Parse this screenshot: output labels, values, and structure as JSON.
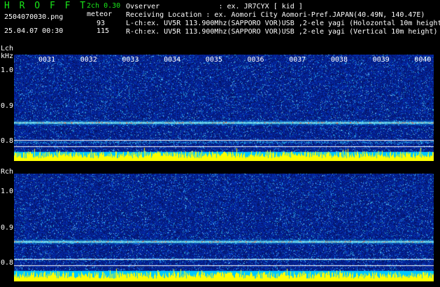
{
  "header": {
    "app_name": "H R O F F T",
    "version": "2ch 0.30",
    "filename": "2504070030.png",
    "mode_label": "meteor",
    "count_lch": "93",
    "count_rch": "115",
    "datetime": "25.04.07 00:30"
  },
  "info": {
    "observer": "Ovserver              : ex. JR7CYX [ kid ]",
    "location": "Receiving Location : ex. Aomori City Aomori-Pref.JAPAN(40.49N, 140.47E)",
    "lch": "L-ch:ex. UV5R 113.900Mhz(SAPPORO VOR)USB ,2-ele yagi (Holozontal 10m height",
    "rch": "R-ch:ex. UV5R 113.900Mhz(SAPPORO VOR)USB ,2-ele yagi (Vertical 10m height)"
  },
  "panels": {
    "lch": {
      "label": "Lch",
      "unit": "kHz",
      "ticks": [
        "1.0",
        "0.9",
        "0.8"
      ]
    },
    "rch": {
      "label": "Rch",
      "ticks": [
        "1.0",
        "0.9",
        "0.8"
      ]
    }
  },
  "time_axis": {
    "minutes": [
      "0031",
      "0032",
      "0033",
      "0034",
      "0035",
      "0036",
      "0037",
      "0038",
      "0039",
      "0040"
    ]
  },
  "colors": {
    "background": "#000000",
    "header_accent": "#19e619",
    "spectrogram_base": "#0a1a8c",
    "signal_band": "#4fd0ff",
    "level_bar": "#ffff00",
    "level_base": "#00c8ff",
    "guide_line": "#ffffff"
  }
}
